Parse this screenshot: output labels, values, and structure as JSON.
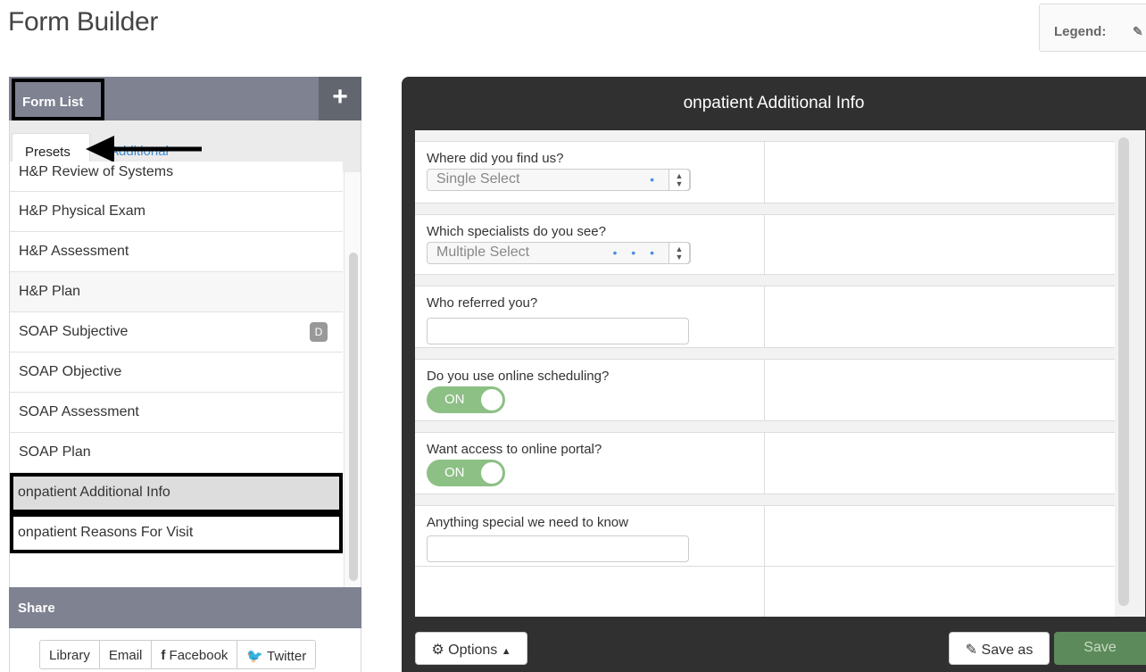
{
  "page": {
    "title": "Form Builder"
  },
  "legend": {
    "label": "Legend:",
    "icon": "pencil-icon"
  },
  "form_list": {
    "title": "Form List",
    "add_label": "+",
    "tabs": {
      "presets": "Presets",
      "additional": "Additional"
    },
    "items": [
      {
        "label": "H&P Review of Systems"
      },
      {
        "label": "H&P Physical Exam"
      },
      {
        "label": "H&P Assessment"
      },
      {
        "label": "H&P Plan"
      },
      {
        "label": "SOAP Subjective",
        "badge": "D"
      },
      {
        "label": "SOAP Objective"
      },
      {
        "label": "SOAP Assessment"
      },
      {
        "label": "SOAP Plan"
      },
      {
        "label": "onpatient Additional Info"
      },
      {
        "label": "onpatient Reasons For Visit"
      }
    ]
  },
  "share": {
    "title": "Share",
    "buttons": {
      "library": "Library",
      "email": "Email",
      "facebook": "Facebook",
      "twitter": "Twitter"
    },
    "facebook_icon": "f",
    "twitter_icon": "twitter-bird-icon"
  },
  "editor": {
    "title": "onpatient Additional Info",
    "fields": [
      {
        "label": "Where did you find us?",
        "type": "select",
        "value": "Single Select",
        "dots": "•"
      },
      {
        "label": "Which specialists do you see?",
        "type": "select",
        "value": "Multiple Select",
        "dots": "• • •"
      },
      {
        "label": "Who referred you?",
        "type": "text"
      },
      {
        "label": "Do you use online scheduling?",
        "type": "toggle",
        "value": "ON"
      },
      {
        "label": "Want access to online portal?",
        "type": "toggle",
        "value": "ON"
      },
      {
        "label": "Anything special we need to know",
        "type": "text"
      }
    ],
    "buttons": {
      "options": "Options",
      "save_as": "Save as",
      "save": "Save"
    }
  },
  "colors": {
    "header_bg": "#7e8291",
    "editor_bg": "#303030",
    "toggle_on": "#8cc084",
    "save_bg": "#5d8a5a",
    "link": "#3d8bd4"
  }
}
